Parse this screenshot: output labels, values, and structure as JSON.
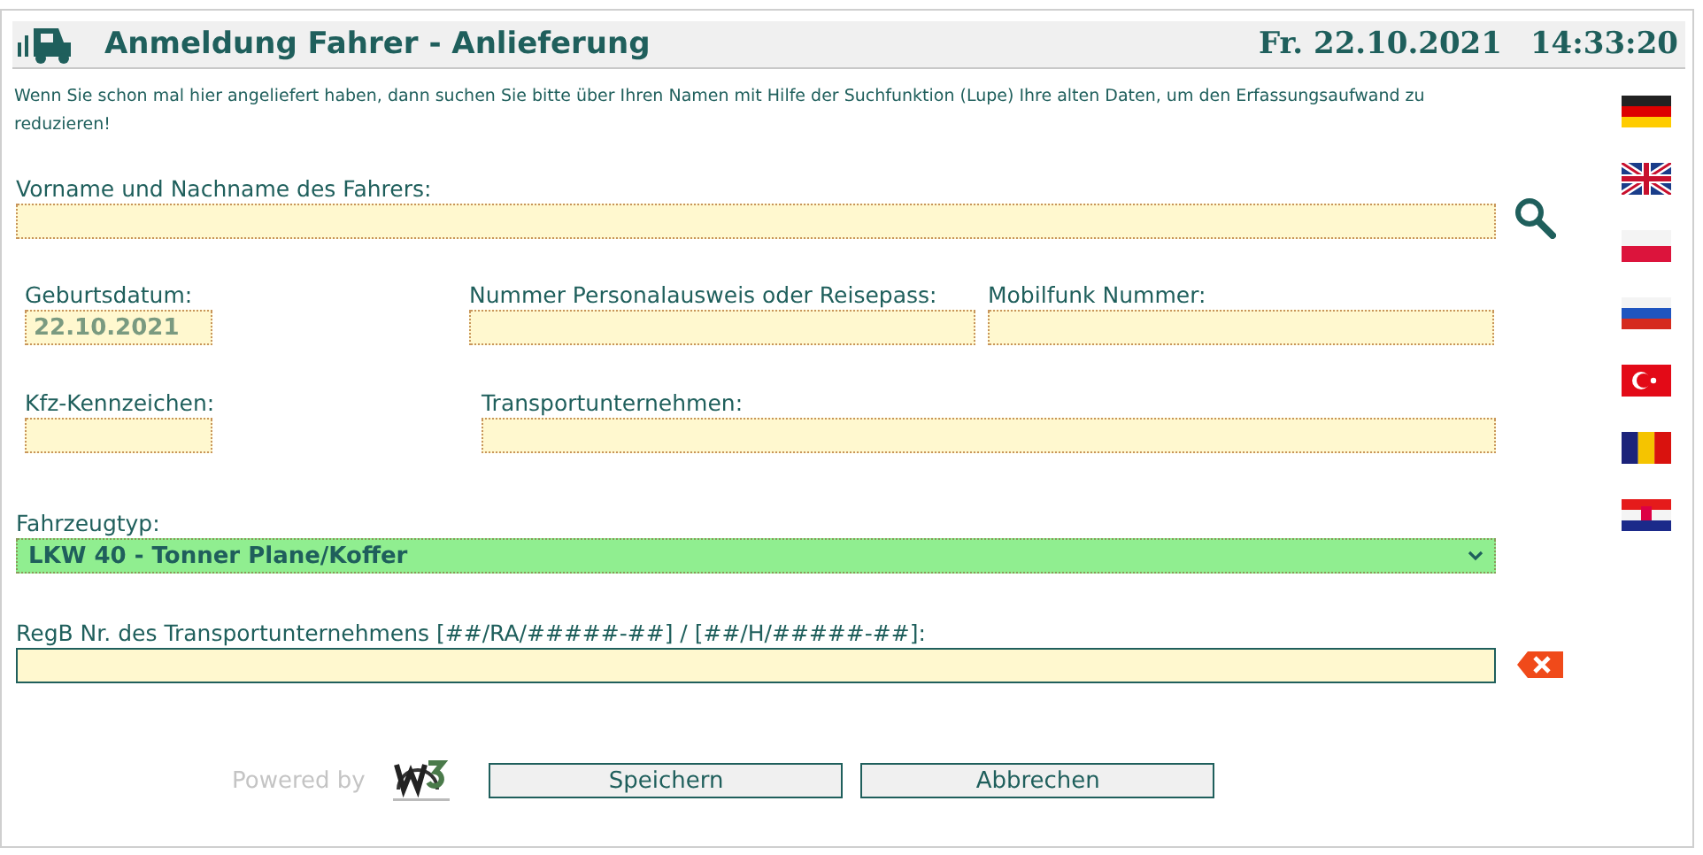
{
  "header": {
    "title": "Anmeldung Fahrer - Anlieferung",
    "date": "Fr. 22.10.2021",
    "time": "14:33:20"
  },
  "intro": "Wenn Sie schon mal hier angeliefert haben, dann suchen Sie bitte über Ihren Namen mit Hilfe der Suchfunktion (Lupe) Ihre alten Daten, um den Erfassungsaufwand zu reduzieren!",
  "name_field": {
    "label": "Vorname und Nachname des Fahrers:"
  },
  "row_1": [
    {
      "label": "Geburtsdatum:",
      "value": "22.10.2021"
    },
    {
      "label": "Nummer Personalausweis oder Reisepass:"
    },
    {
      "label": "Mobilfunk Nummer:"
    }
  ],
  "row_2": [
    {
      "label": "Kfz-Kennzeichen:"
    },
    {
      "label": "Transportunternehmen:"
    }
  ],
  "vehicle_type": {
    "label": "Fahrzeugtyp:",
    "value": "LKW 40 - Tonner Plane/Koffer"
  },
  "regb_field": {
    "label": "RegB Nr. des Transportunternehmens [##/RA/#####-##] / [##/H/#####-##]:"
  },
  "footer": {
    "powered_by": "Powered by"
  },
  "buttons": [
    "Speichern",
    "Abbrechen"
  ],
  "languages": [
    {
      "kind": "de"
    },
    {
      "kind": "gb"
    },
    {
      "kind": "pl"
    },
    {
      "kind": "ru"
    },
    {
      "kind": "tr"
    },
    {
      "kind": "ro"
    },
    {
      "kind": "hr"
    }
  ]
}
